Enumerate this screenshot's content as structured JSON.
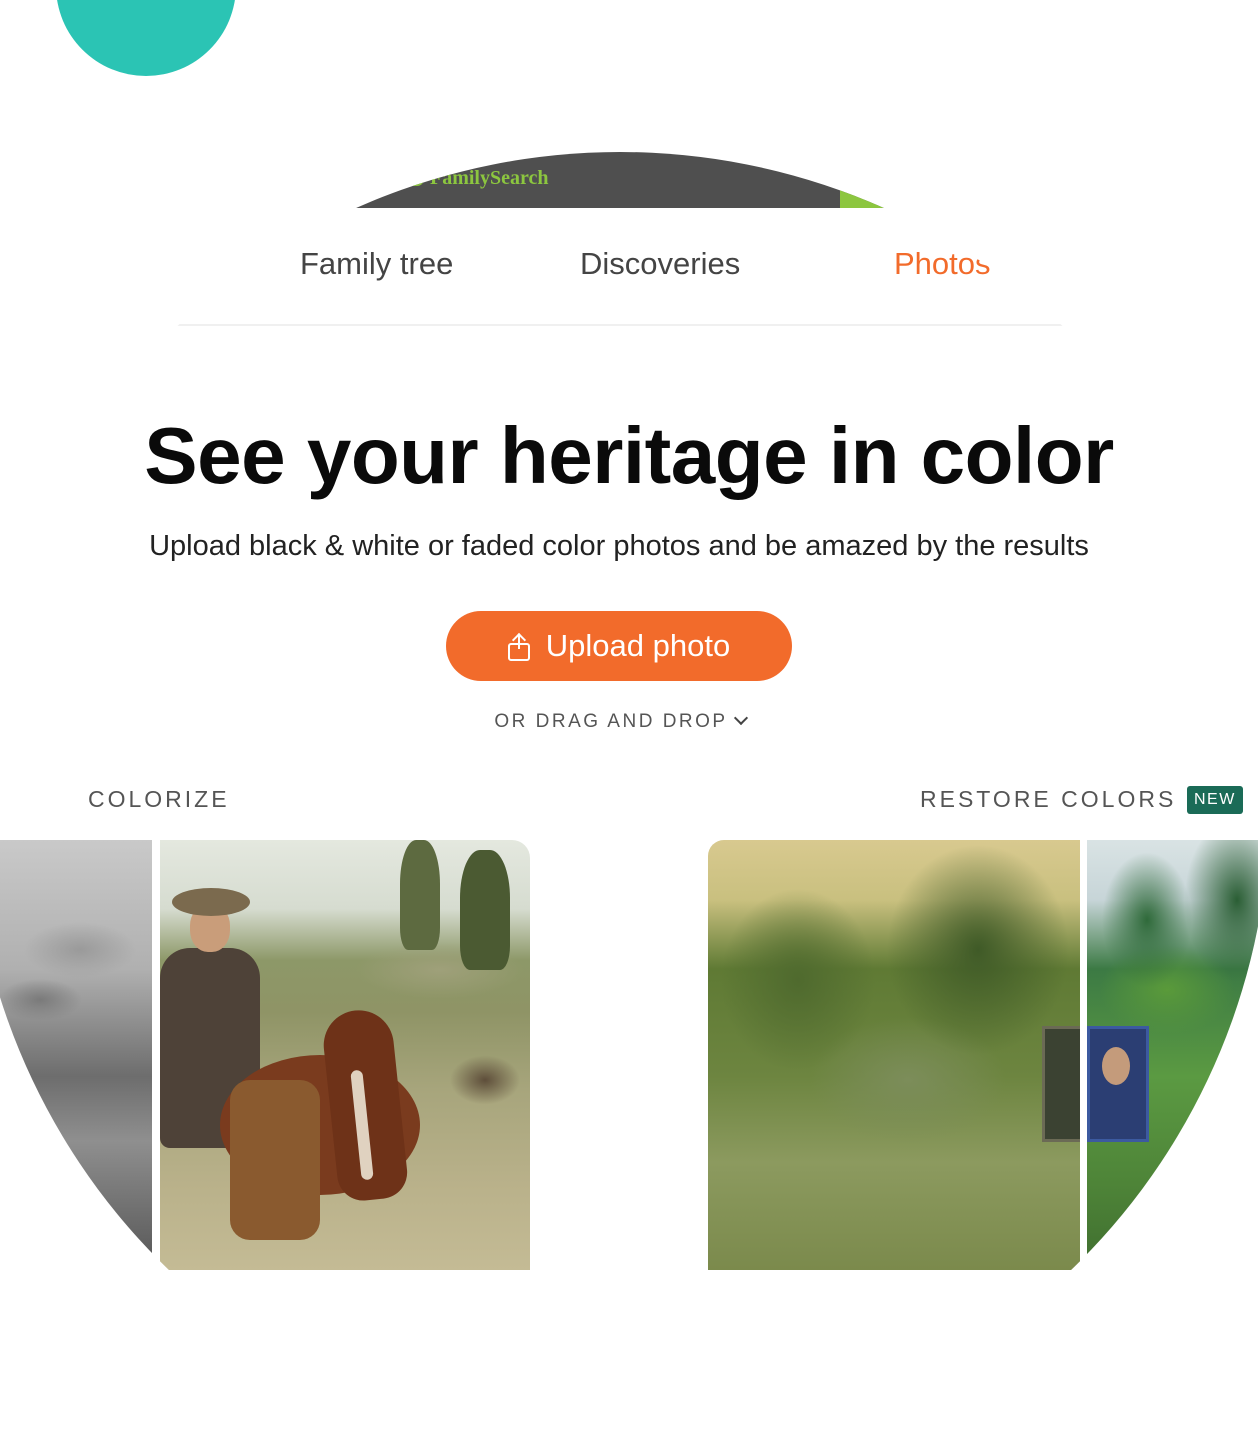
{
  "header": {
    "brand": "FamilySearch",
    "brand_color": "#8cc63f",
    "bar_color": "#4f4f4f"
  },
  "nav": {
    "tabs": [
      {
        "label": "Family tree",
        "active": false
      },
      {
        "label": "Discoveries",
        "active": false
      },
      {
        "label": "Photos",
        "active": true
      }
    ],
    "active_color": "#f26b2b"
  },
  "hero": {
    "title": "See your heritage in color",
    "subtitle": "Upload black & white or faded color photos and be amazed by the results",
    "upload_label": "Upload photo",
    "upload_icon": "upload-icon",
    "button_color": "#f26b2b",
    "drag_drop": "OR DRAG AND DROP",
    "drag_drop_icon": "chevron-down-icon"
  },
  "sections": {
    "colorize": "COLORIZE",
    "restore": "RESTORE COLORS",
    "new_badge": "NEW",
    "badge_color": "#1a6b57"
  },
  "decor": {
    "accent_blob_color": "#2bc4b4"
  }
}
